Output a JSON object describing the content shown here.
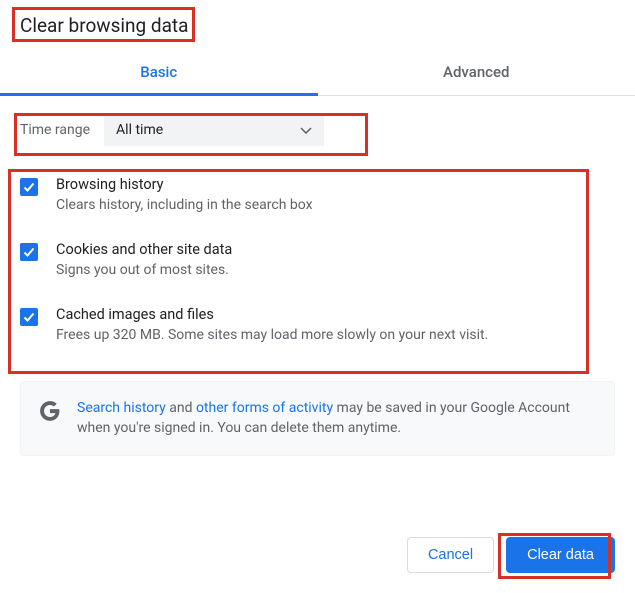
{
  "title": "Clear browsing data",
  "tabs": {
    "basic": "Basic",
    "advanced": "Advanced"
  },
  "timerange": {
    "label": "Time range",
    "value": "All time"
  },
  "options": [
    {
      "title": "Browsing history",
      "desc": "Clears history, including in the search box"
    },
    {
      "title": "Cookies and other site data",
      "desc": "Signs you out of most sites."
    },
    {
      "title": "Cached images and files",
      "desc": "Frees up 320 MB. Some sites may load more slowly on your next visit."
    }
  ],
  "info": {
    "link1": "Search history",
    "mid1": " and ",
    "link2": "other forms of activity",
    "rest": " may be saved in your Google Account when you're signed in. You can delete them anytime."
  },
  "buttons": {
    "cancel": "Cancel",
    "clear": "Clear data"
  }
}
